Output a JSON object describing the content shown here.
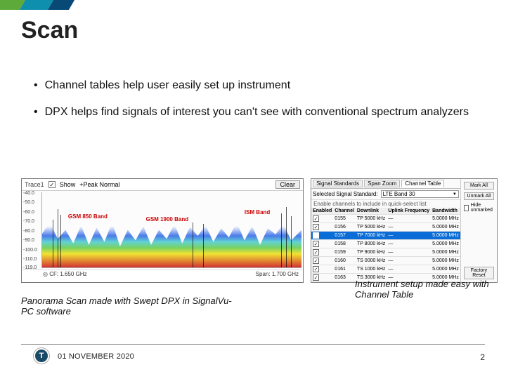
{
  "title": "Scan",
  "bullets": [
    "Channel tables help user easily set up instrument",
    "DPX helps find signals of interest you can't see with conventional spectrum analyzers"
  ],
  "spectrum": {
    "trace_label": "Trace1",
    "show_checked": true,
    "mode_label": "+Peak Normal",
    "clear_label": "Clear",
    "ylabels": [
      "-40.0",
      "-50.0",
      "-60.0",
      "-70.0",
      "-80.0",
      "-90.0",
      "-100.0",
      "-110.0",
      "-119.0"
    ],
    "annotations": {
      "gsm850": "GSM 850 Band",
      "gsm1900": "GSM 1900 Band",
      "ism": "ISM Band"
    },
    "footer": {
      "cf_label": "CF:",
      "cf_value": "1.650 GHz",
      "span_label": "Span:",
      "span_value": "1.700 GHz"
    }
  },
  "channel_table": {
    "tabs": [
      "Signal Standards",
      "Span Zoom",
      "Channel Table"
    ],
    "active_tab": 2,
    "label_enable": "Enable channels to include in quick-select list",
    "label_signal_std": "Selected Signal Standard:",
    "signal_std_value": "LTE Band 30",
    "columns": [
      "Enabled",
      "Channel",
      "Downlink",
      "Uplink Frequency",
      "Bandwidth"
    ],
    "rows": [
      {
        "enabled": true,
        "channel": "0155",
        "downlink": "TP 5000 kHz",
        "uplink": "—",
        "bw": "5.0000 MHz",
        "selected": false
      },
      {
        "enabled": true,
        "channel": "0156",
        "downlink": "TP 5000 kHz",
        "uplink": "—",
        "bw": "5.0000 MHz",
        "selected": false
      },
      {
        "enabled": true,
        "channel": "0157",
        "downlink": "TP 7000 kHz",
        "uplink": "—",
        "bw": "5.0000 MHz",
        "selected": true
      },
      {
        "enabled": true,
        "channel": "0158",
        "downlink": "TP 8000 kHz",
        "uplink": "—",
        "bw": "5.0000 MHz",
        "selected": false
      },
      {
        "enabled": true,
        "channel": "0159",
        "downlink": "TP 9000 kHz",
        "uplink": "—",
        "bw": "5.0000 MHz",
        "selected": false
      },
      {
        "enabled": true,
        "channel": "0160",
        "downlink": "TS 0000 kHz",
        "uplink": "—",
        "bw": "5.0000 MHz",
        "selected": false
      },
      {
        "enabled": true,
        "channel": "0161",
        "downlink": "TS 1000 kHz",
        "uplink": "—",
        "bw": "5.0000 MHz",
        "selected": false
      },
      {
        "enabled": true,
        "channel": "0163",
        "downlink": "TS 3000 kHz",
        "uplink": "—",
        "bw": "5.0000 MHz",
        "selected": false
      }
    ],
    "right": {
      "mark_all": "Mark All",
      "unmark_all": "Unmark All",
      "hide_unmarked": "Hide unmarked",
      "factory_reset": "Factory Reset"
    }
  },
  "captions": {
    "left": "Panorama Scan made with Swept DPX in SignalVu-PC software",
    "right": "Instrument setup made easy with Channel Table"
  },
  "footer": {
    "date": "01 NOVEMBER 2020",
    "page": "2",
    "logo_letter": "T"
  }
}
